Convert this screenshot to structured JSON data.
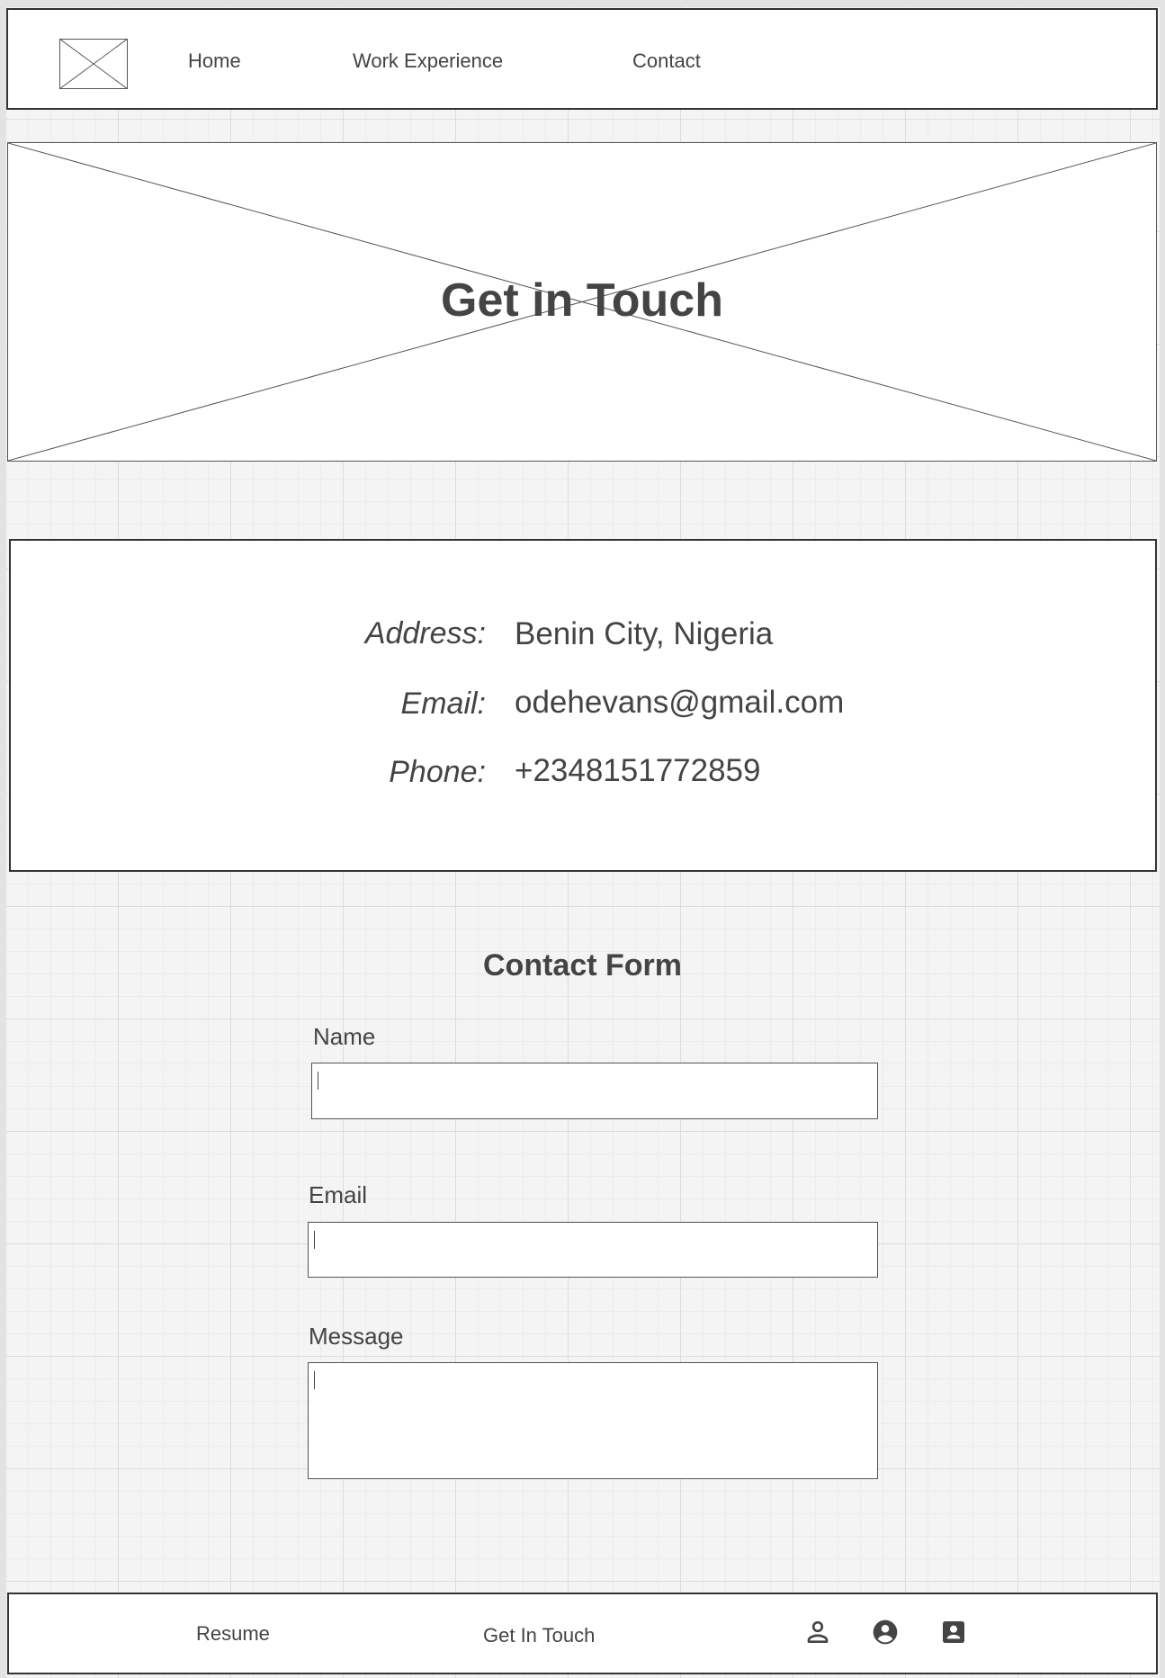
{
  "nav": {
    "logo_alt": "logo placeholder",
    "items": [
      {
        "label": "Home"
      },
      {
        "label": "Work Experience"
      },
      {
        "label": "Contact"
      }
    ]
  },
  "hero": {
    "title": "Get in Touch"
  },
  "contact_info": {
    "address_label": "Address:",
    "address_value": "Benin City, Nigeria",
    "email_label": "Email:",
    "email_value": "odehevans@gmail.com",
    "phone_label": "Phone:",
    "phone_value": "+2348151772859"
  },
  "form": {
    "title": "Contact Form",
    "name_label": "Name",
    "name_value": "",
    "email_label": "Email",
    "email_value": "",
    "message_label": "Message",
    "message_value": ""
  },
  "footer": {
    "resume_label": "Resume",
    "get_in_touch_label": "Get In Touch",
    "icons": [
      "person-outline-icon",
      "account-circle-icon",
      "contact-card-icon"
    ]
  },
  "colors": {
    "text": "#444444",
    "border": "#333333",
    "grid": "#dcdcdc"
  }
}
